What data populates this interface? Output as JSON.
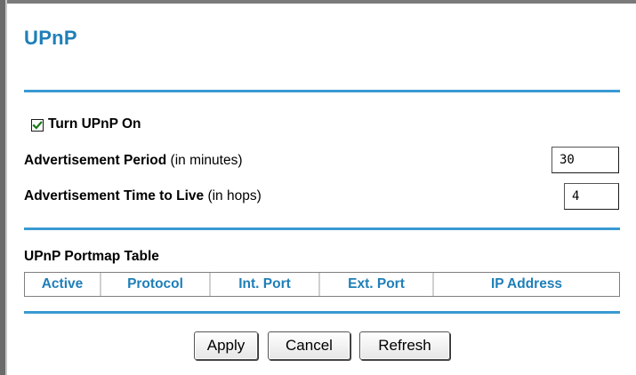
{
  "page": {
    "title": "UPnP"
  },
  "upnp": {
    "turn_on_label": "Turn UPnP On",
    "turn_on_checked": true,
    "advertisement_period": {
      "label_bold": "Advertisement Period",
      "label_suffix": "(in minutes)",
      "value": "30"
    },
    "advertisement_ttl": {
      "label_bold": "Advertisement Time to Live",
      "label_suffix": "(in hops)",
      "value": "4"
    }
  },
  "portmap": {
    "title": "UPnP Portmap Table",
    "columns": [
      "Active",
      "Protocol",
      "Int. Port",
      "Ext. Port",
      "IP Address"
    ]
  },
  "buttons": {
    "apply": "Apply",
    "cancel": "Cancel",
    "refresh": "Refresh"
  },
  "colors": {
    "accent": "#1e7fb8",
    "rule": "#3a9ad2"
  }
}
